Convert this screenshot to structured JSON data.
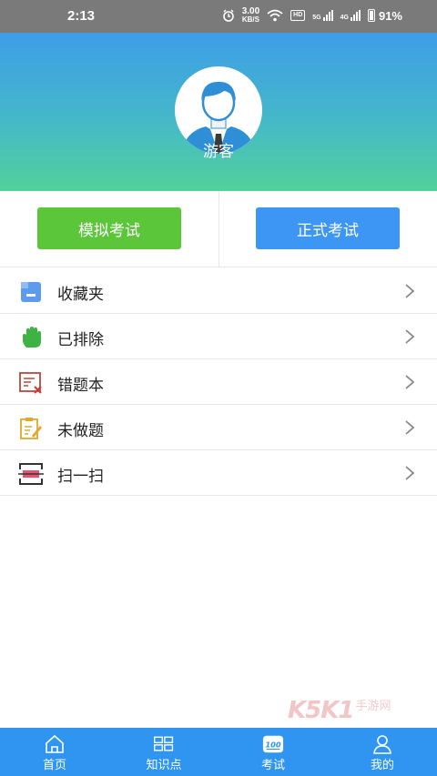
{
  "status_bar": {
    "time": "2:13",
    "net_speed_value": "3.00",
    "net_speed_unit": "KB/S",
    "hd_label": "HD",
    "signal1_label": "5G",
    "signal2_label": "4G",
    "battery": "91%"
  },
  "header": {
    "user_name": "游客"
  },
  "exam": {
    "mock_label": "模拟考试",
    "formal_label": "正式考试"
  },
  "menu": {
    "items": [
      {
        "label": "收藏夹",
        "icon": "folder-icon"
      },
      {
        "label": "已排除",
        "icon": "hand-icon"
      },
      {
        "label": "错题本",
        "icon": "wrong-note-icon"
      },
      {
        "label": "未做题",
        "icon": "edit-note-icon"
      },
      {
        "label": "扫一扫",
        "icon": "scan-icon"
      }
    ]
  },
  "watermark": {
    "logo": "K5K1",
    "text": "手游网"
  },
  "tabbar": {
    "tabs": [
      {
        "label": "首页",
        "icon": "home-icon"
      },
      {
        "label": "知识点",
        "icon": "grid-icon"
      },
      {
        "label": "考试",
        "icon": "exam-icon",
        "active": true
      },
      {
        "label": "我的",
        "icon": "profile-icon"
      }
    ],
    "background": "#2f95f1"
  },
  "colors": {
    "mock_button": "#5cc63a",
    "formal_button": "#3d96f4"
  }
}
